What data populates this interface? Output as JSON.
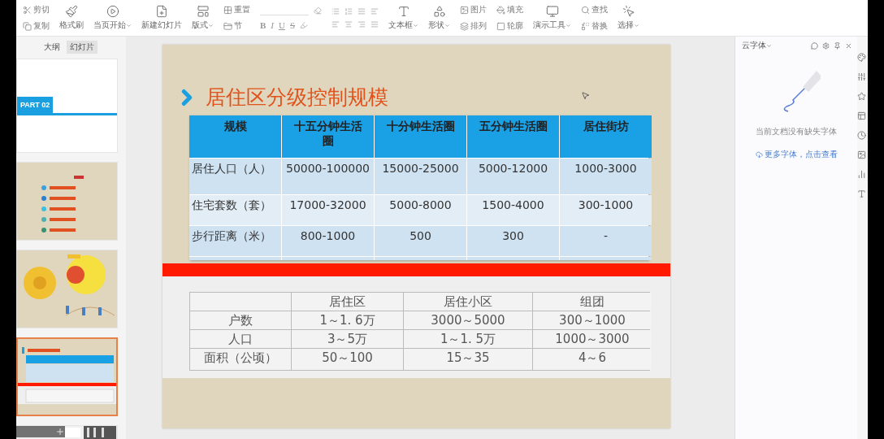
{
  "ribbon": {
    "items": [
      {
        "kind": "stack",
        "items": [
          {
            "label": "剪切"
          },
          {
            "label": "复制"
          }
        ]
      },
      {
        "kind": "large",
        "label": "格式刷",
        "dropdown": false
      },
      {
        "kind": "large",
        "label": "当页开始",
        "dropdown": true
      },
      {
        "kind": "large",
        "label": "新建幻灯片",
        "dropdown": false
      },
      {
        "kind": "large",
        "label": "版式",
        "dropdown": true
      },
      {
        "kind": "stack",
        "items": [
          {
            "label": "重置"
          },
          {
            "label": "节"
          }
        ]
      },
      {
        "kind": "format",
        "glyphs": [
          "B",
          "I",
          "U",
          "S"
        ]
      },
      {
        "kind": "paragraph"
      },
      {
        "kind": "large",
        "label": "文本框",
        "dropdown": true
      },
      {
        "kind": "large",
        "label": "形状",
        "dropdown": true
      },
      {
        "kind": "stack",
        "items": [
          {
            "label": "图片"
          },
          {
            "label": "排列"
          }
        ]
      },
      {
        "kind": "stack",
        "items": [
          {
            "label": "填充"
          },
          {
            "label": "轮廓"
          }
        ]
      },
      {
        "kind": "large",
        "label": "演示工具",
        "dropdown": true
      },
      {
        "kind": "stack",
        "items": [
          {
            "label": "查找"
          },
          {
            "label": "替换"
          }
        ]
      },
      {
        "kind": "large",
        "label": "选择",
        "dropdown": true
      }
    ]
  },
  "panel_tabs": [
    {
      "label": "大纲",
      "selected": false
    },
    {
      "label": "幻灯片",
      "selected": true
    }
  ],
  "thumbnails": [
    {
      "kind": "part",
      "label": "PART 02",
      "selected": false
    },
    {
      "kind": "contents",
      "selected": false
    },
    {
      "kind": "diagram",
      "selected": false
    },
    {
      "kind": "tables",
      "selected": true
    },
    {
      "kind": "scan",
      "selected": false
    }
  ],
  "slide": {
    "title": "居住区分级控制规模",
    "table1": {
      "columns": [
        "规模",
        "十五分钟生活圈",
        "十分钟生活圈",
        "五分钟生活圈",
        "居住街坊"
      ],
      "rows": [
        [
          "居住人口（人）",
          "50000-100000",
          "15000-25000",
          "5000-12000",
          "1000-3000"
        ],
        [
          "住宅套数（套）",
          "17000-32000",
          "5000-8000",
          "1500-4000",
          "300-1000"
        ],
        [
          "步行距离（米）",
          "800-1000",
          "500",
          "300",
          "-"
        ]
      ]
    },
    "table2": {
      "columns": [
        "",
        "居住区",
        "居住小区",
        "组团"
      ],
      "rows": [
        [
          "户数",
          "1～1. 6万",
          "3000～5000",
          "300～1000"
        ],
        [
          "人口",
          "3～5万",
          "1～1. 5万",
          "1000～3000"
        ],
        [
          "面积（公顷）",
          "50～100",
          "15～35",
          "4～6"
        ]
      ]
    }
  },
  "side_panel": {
    "title": "云字体",
    "message": "当前文档没有缺失字体",
    "link": "更多字体，点击查看"
  }
}
